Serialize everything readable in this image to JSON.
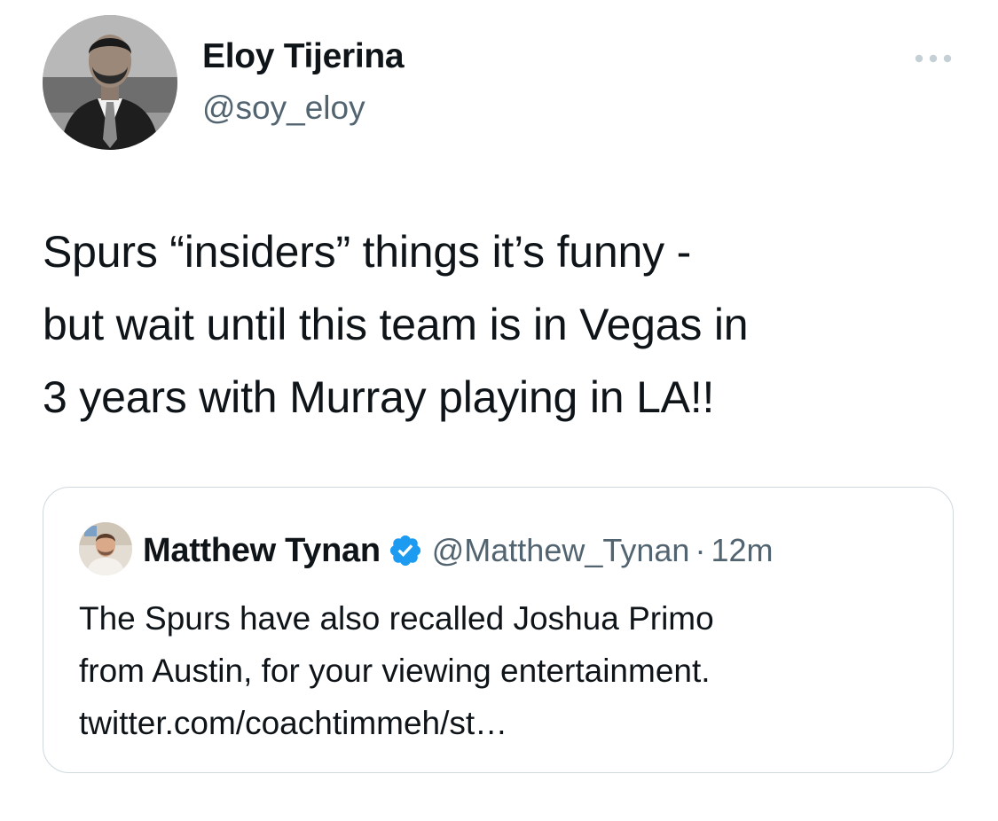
{
  "tweet": {
    "author": {
      "display_name": "Eloy Tijerina",
      "handle": "@soy_eloy",
      "avatar_icon": "profile-photo"
    },
    "more_icon": "more-horizontal-icon",
    "text_lines": [
      "Spurs “insiders” things it’s funny -",
      "but wait until this team is in Vegas in",
      "3 years with Murray playing in LA!!"
    ]
  },
  "quote": {
    "author": {
      "display_name": "Matthew Tynan",
      "verified": true,
      "verified_icon": "verified-badge-icon",
      "handle": "@Matthew_Tynan",
      "separator": "·",
      "time": "12m"
    },
    "text_lines": [
      "The Spurs have also recalled Joshua Primo",
      "from Austin, for your viewing entertainment.",
      "twitter.com/coachtimmeh/st…"
    ]
  },
  "colors": {
    "text_primary": "#0f1419",
    "text_secondary": "#536471",
    "border": "#cfd9de",
    "verified_blue": "#1d9bf0"
  }
}
